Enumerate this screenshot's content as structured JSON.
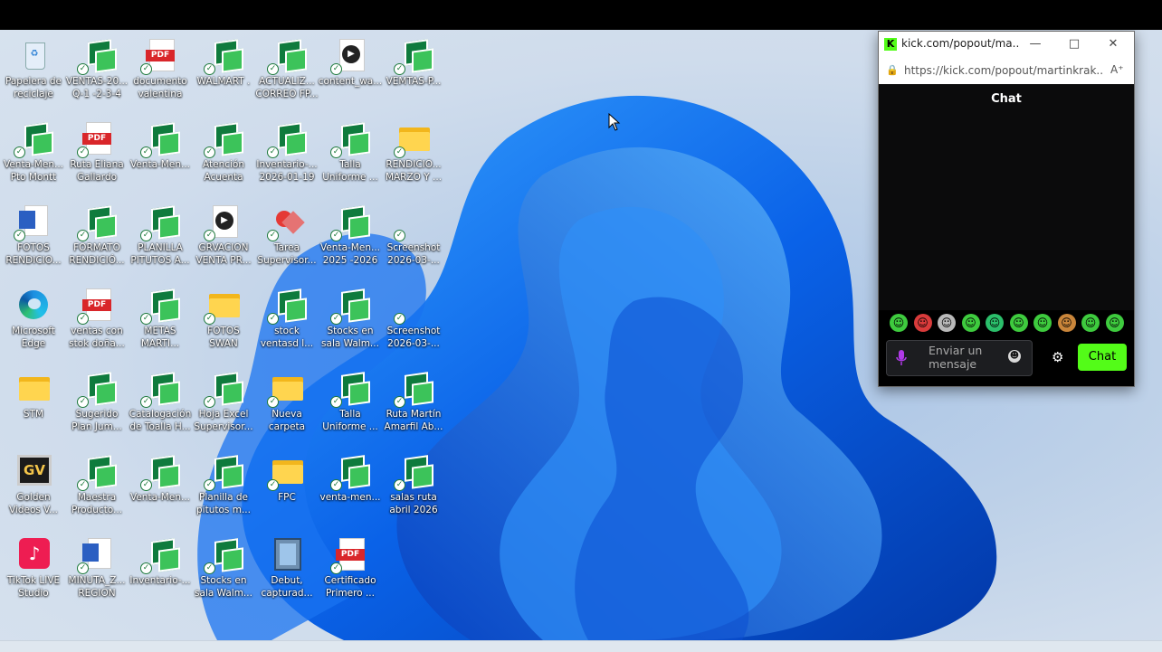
{
  "desktop": {
    "icons": [
      {
        "label": "Papelera de\nreciclaje",
        "kind": "bin",
        "synced": false
      },
      {
        "label": "VENTAS-20...\nQ-1 -2-3-4",
        "kind": "sheets",
        "synced": true
      },
      {
        "label": "documento\nvalentina",
        "kind": "pdf",
        "synced": true
      },
      {
        "label": "WALMART .",
        "kind": "sheets",
        "synced": true
      },
      {
        "label": "ACTUALIZ...\nCORREO FP...",
        "kind": "sheets",
        "synced": true
      },
      {
        "label": "content_wa...",
        "kind": "video",
        "synced": true
      },
      {
        "label": "VEMTAS-P...",
        "kind": "sheets",
        "synced": true
      },
      {
        "label": "Venta-Men...\nPto Montt",
        "kind": "sheets",
        "synced": true
      },
      {
        "label": "Ruta Eliana\nGallardo",
        "kind": "pdf",
        "synced": true
      },
      {
        "label": "Venta-Men...",
        "kind": "sheets",
        "synced": true
      },
      {
        "label": "Atención\nAcuenta",
        "kind": "sheets",
        "synced": true
      },
      {
        "label": "Inventario-...\n2026-01-19",
        "kind": "sheets",
        "synced": true
      },
      {
        "label": "Talla\nUniforme ...",
        "kind": "sheets",
        "synced": true
      },
      {
        "label": "RENDICIO...\nMARZO Y ...",
        "kind": "folder",
        "synced": true
      },
      {
        "label": "FOTOS\nRENDICIO...",
        "kind": "word",
        "synced": true
      },
      {
        "label": "FORMATO\nRENDICIÓ...",
        "kind": "sheets",
        "synced": true
      },
      {
        "label": "PLANILLA\nPITUTOS A...",
        "kind": "sheets",
        "synced": true
      },
      {
        "label": "GRVACION\nVENTA PR...",
        "kind": "video",
        "synced": true
      },
      {
        "label": "Tarea\nSupervisor...",
        "kind": "shape",
        "synced": true
      },
      {
        "label": "Venta-Men...\n2025 -2026",
        "kind": "sheets",
        "synced": true
      },
      {
        "label": "Screenshot\n2026-03-...",
        "kind": "image",
        "synced": true
      },
      {
        "label": "Microsoft\nEdge",
        "kind": "edge",
        "synced": false
      },
      {
        "label": "ventas con\nstok doña...",
        "kind": "pdf",
        "synced": true
      },
      {
        "label": "METAS\nMARTI...",
        "kind": "sheets",
        "synced": true
      },
      {
        "label": "FOTOS\nSWAN",
        "kind": "folder",
        "synced": true
      },
      {
        "label": "stock\nventasd l...",
        "kind": "sheets",
        "synced": true
      },
      {
        "label": "Stocks en\nsala Walm...",
        "kind": "sheets",
        "synced": true
      },
      {
        "label": "Screenshot\n2026-03-...",
        "kind": "image",
        "synced": true
      },
      {
        "label": "STM",
        "kind": "folder",
        "synced": false
      },
      {
        "label": "Sugerido\nPlan Jum...",
        "kind": "sheets",
        "synced": true
      },
      {
        "label": "Catalogación\nde Toalla H...",
        "kind": "sheets",
        "synced": true
      },
      {
        "label": "Hoja Excel\nSupervisor...",
        "kind": "sheets",
        "synced": true
      },
      {
        "label": "Nueva\ncarpeta",
        "kind": "folder",
        "synced": true
      },
      {
        "label": "Talla\nUniforme ...",
        "kind": "sheets",
        "synced": true
      },
      {
        "label": "Ruta Martín\nAmarfil Ab...",
        "kind": "sheets",
        "synced": true
      },
      {
        "label": "Golden\nVideos V...",
        "kind": "gv",
        "synced": false
      },
      {
        "label": "Maestra\nProducto...",
        "kind": "sheets",
        "synced": true
      },
      {
        "label": "Venta-Men...",
        "kind": "sheets",
        "synced": true
      },
      {
        "label": "Planilla de\npitutos  m...",
        "kind": "sheets",
        "synced": true
      },
      {
        "label": "FPC",
        "kind": "folder",
        "synced": true
      },
      {
        "label": "venta-men...",
        "kind": "sheets",
        "synced": true
      },
      {
        "label": "salas ruta\nabril 2026",
        "kind": "sheets",
        "synced": true
      },
      {
        "label": "TikTok LIVE\nStudio",
        "kind": "tiktok",
        "synced": false
      },
      {
        "label": "MINUTA_Z...\nREGION",
        "kind": "word",
        "synced": true
      },
      {
        "label": "Inventario-...",
        "kind": "sheets",
        "synced": true
      },
      {
        "label": "Stocks en\nsala Walm...",
        "kind": "sheets",
        "synced": true
      },
      {
        "label": "Debut,\ncapturad...",
        "kind": "film",
        "synced": false
      },
      {
        "label": "Certificado\nPrimero ...",
        "kind": "pdf",
        "synced": true
      }
    ],
    "columns_per_row": [
      7,
      7,
      7,
      7,
      7,
      7,
      6
    ]
  },
  "chat_window": {
    "titlebar": "kick.com/popout/ma...",
    "favicon": "K",
    "minimize_icon": "minimize-icon",
    "maximize_icon": "maximize-icon",
    "close_icon": "close-icon",
    "address": "https://kick.com/popout/martinkrak...",
    "reader_icon": "reader-mode-icon",
    "chat_header": "Chat",
    "input_placeholder": "Enviar un\nmensaje",
    "send_label": "Chat",
    "settings_icon": "gear-icon",
    "emotes": [
      {
        "name": "emote-1",
        "color": "#3ecb3e"
      },
      {
        "name": "emote-2",
        "color": "#d93b3b"
      },
      {
        "name": "emote-3",
        "color": "#b9b9b9"
      },
      {
        "name": "emote-4",
        "color": "#3ecb3e"
      },
      {
        "name": "emote-5",
        "color": "#2bbf6b"
      },
      {
        "name": "emote-6",
        "color": "#3ecb3e"
      },
      {
        "name": "emote-7",
        "color": "#3ecb3e"
      },
      {
        "name": "emote-8",
        "color": "#c9853a"
      },
      {
        "name": "emote-9",
        "color": "#3ecb3e"
      },
      {
        "name": "emote-10",
        "color": "#3ecb3e"
      }
    ],
    "accent": "#53fc18"
  }
}
